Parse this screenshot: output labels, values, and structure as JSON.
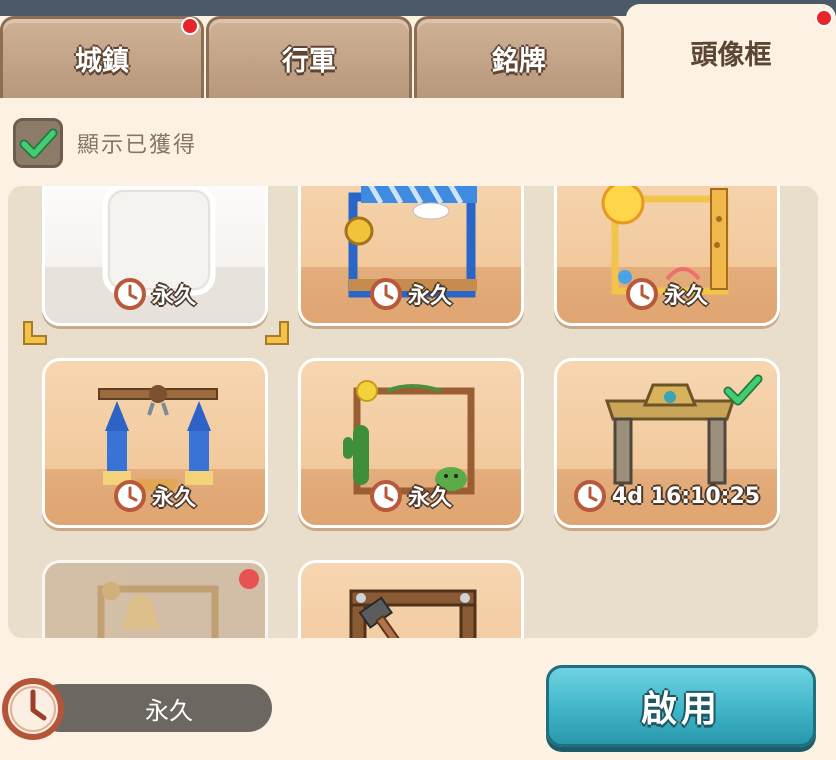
{
  "tabs": [
    {
      "label": "城鎮",
      "active": false,
      "badge": true
    },
    {
      "label": "行軍",
      "active": false,
      "badge": false
    },
    {
      "label": "銘牌",
      "active": false,
      "badge": false
    },
    {
      "label": "頭像框",
      "active": true,
      "badge": true
    }
  ],
  "filter": {
    "label": "顯示已獲得",
    "checked": true
  },
  "frames": [
    {
      "name": "empty",
      "time": "永久",
      "selected": true,
      "owned": true
    },
    {
      "name": "blue-medal",
      "time": "永久",
      "selected": false,
      "owned": true
    },
    {
      "name": "sun-giraffe",
      "time": "永久",
      "selected": false,
      "owned": true
    },
    {
      "name": "blue-towers",
      "time": "永久",
      "selected": false,
      "owned": true
    },
    {
      "name": "cactus",
      "time": "永久",
      "selected": false,
      "owned": true
    },
    {
      "name": "golden-gate",
      "time": "4d 16:10:25",
      "selected": false,
      "owned": true,
      "equipped": true
    },
    {
      "name": "bell",
      "time": "",
      "selected": false,
      "owned": false,
      "badge": true
    },
    {
      "name": "hammer",
      "time": "",
      "selected": false,
      "owned": true
    }
  ],
  "footer": {
    "duration": "永久",
    "enable_label": "啟用"
  },
  "colors": {
    "accent": "#3fb5c7",
    "badge": "#e8232a",
    "check": "#3ec06a"
  }
}
